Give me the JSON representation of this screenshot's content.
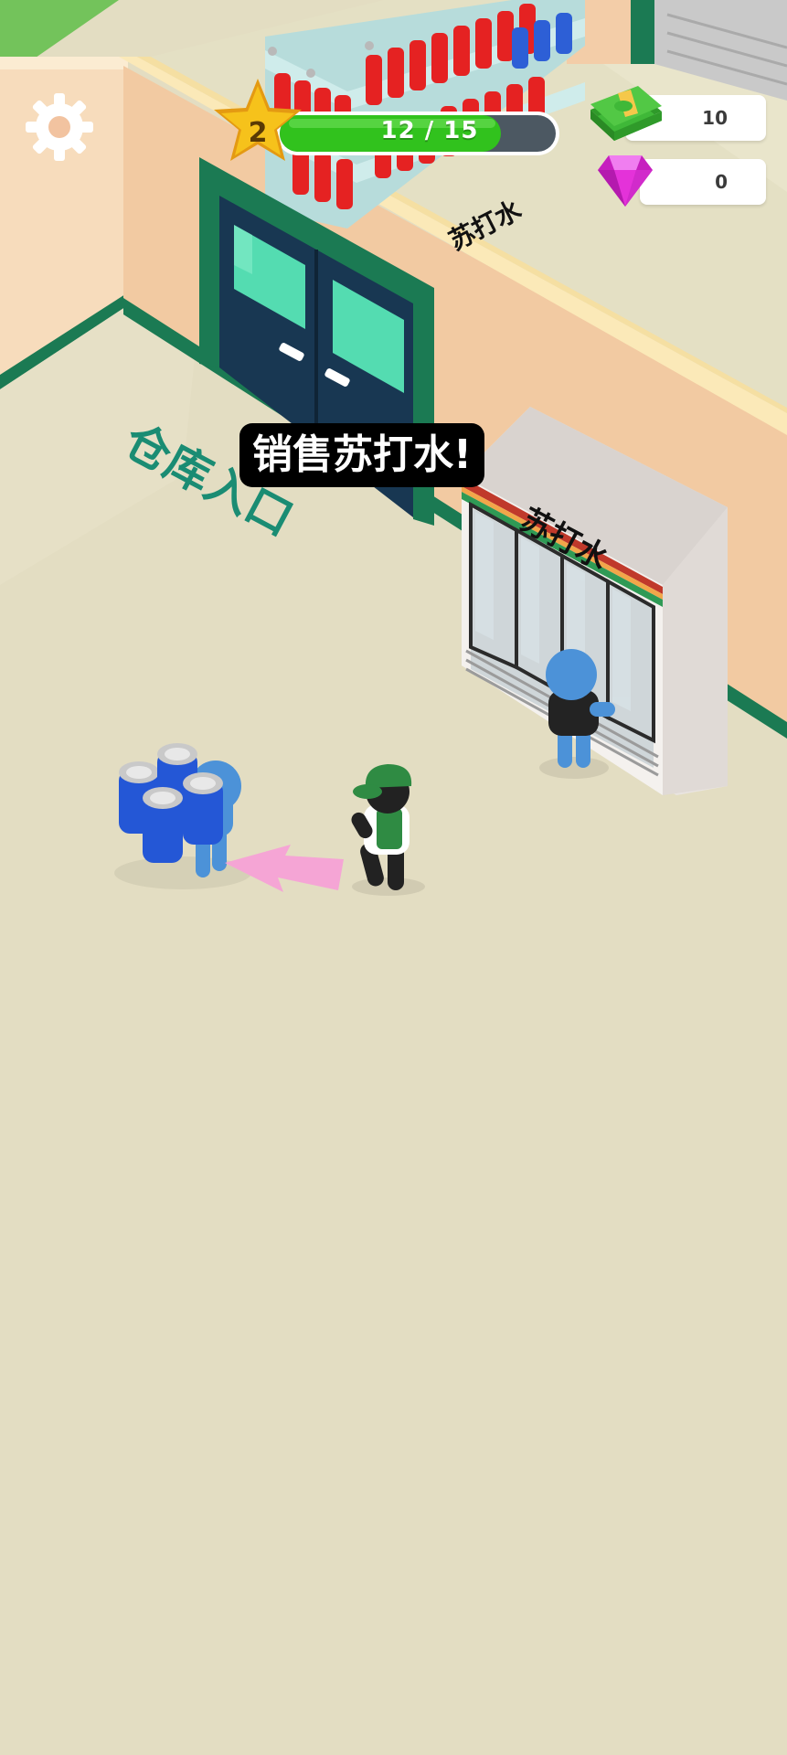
{
  "hud": {
    "level": "2",
    "progress_text": "12 / 15",
    "progress_fraction": 0.8,
    "cash": "10",
    "gems": "0",
    "icons": {
      "settings": "gear-icon",
      "level": "star-icon",
      "cash": "cash-stack-icon",
      "gems": "gem-icon"
    }
  },
  "hint": "销售苏打水!",
  "signs": {
    "shelf_label": "苏打水",
    "fridge_label": "苏打水",
    "floor_label": "仓库入口"
  },
  "colors": {
    "floor": "#e3ddc2",
    "wall": "#f2caa2",
    "trim": "#1b7a53",
    "door": "#183752",
    "glass": "#54dcb1",
    "progress_fill": "#31c21d",
    "progress_track": "#4c5862",
    "star": "#f6c21b",
    "gem": "#e432d9",
    "arrow": "#f5a5d5",
    "customer": "#4c92d8",
    "worker_cap": "#2f8b43",
    "can": "#2457d6"
  }
}
